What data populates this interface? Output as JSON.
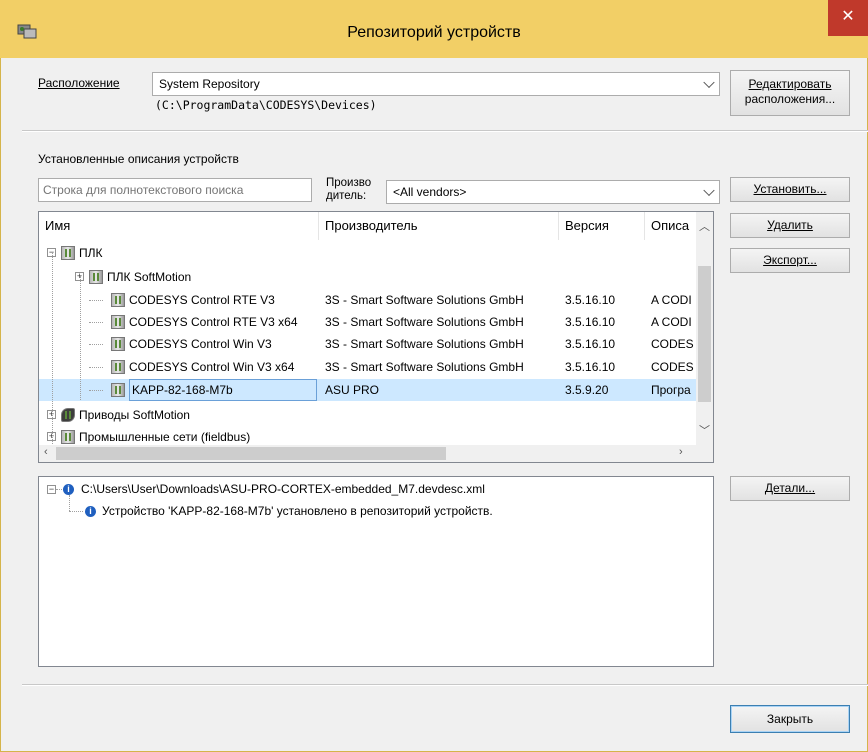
{
  "window": {
    "title": "Репозиторий устройств",
    "close_glyph": "✕"
  },
  "location": {
    "label": "Расположение",
    "selected": "System Repository",
    "path": "(C:\\ProgramData\\CODESYS\\Devices)",
    "edit_button_line1": "Редактировать",
    "edit_button_line2": "расположения..."
  },
  "installed": {
    "heading": "Установленные описания устройств",
    "search_placeholder": "Строка для полнотекстового поиска",
    "vendor_label_line1": "Произво",
    "vendor_label_line2": "дитель:",
    "vendor_selected": "<All vendors>"
  },
  "grid": {
    "columns": [
      "Имя",
      "Производитель",
      "Версия",
      "Описа"
    ],
    "rows": [
      {
        "name": "ПЛК",
        "vendor": "",
        "version": "",
        "desc": "",
        "expander": "−"
      },
      {
        "name": "ПЛК SoftMotion",
        "vendor": "",
        "version": "",
        "desc": "",
        "expander": "+"
      },
      {
        "name": "CODESYS Control RTE V3",
        "vendor": "3S - Smart Software Solutions GmbH",
        "version": "3.5.16.10",
        "desc": "A CODI"
      },
      {
        "name": "CODESYS Control RTE V3 x64",
        "vendor": "3S - Smart Software Solutions GmbH",
        "version": "3.5.16.10",
        "desc": "A CODI"
      },
      {
        "name": "CODESYS Control Win V3",
        "vendor": "3S - Smart Software Solutions GmbH",
        "version": "3.5.16.10",
        "desc": "CODES"
      },
      {
        "name": "CODESYS Control Win V3 x64",
        "vendor": "3S - Smart Software Solutions GmbH",
        "version": "3.5.16.10",
        "desc": "CODES"
      },
      {
        "name": "KAPP-82-168-M7b",
        "vendor": "ASU PRO",
        "version": "3.5.9.20",
        "desc": "Програ",
        "selected": true
      },
      {
        "name": "Приводы SoftMotion",
        "vendor": "",
        "version": "",
        "desc": "",
        "expander": "+"
      },
      {
        "name": "Промышленные сети (fieldbus)",
        "vendor": "",
        "version": "",
        "desc": "",
        "expander": "+"
      }
    ]
  },
  "buttons": {
    "install": "Установить...",
    "delete": "Удалить",
    "export": "Экспорт...",
    "details": "Детали...",
    "close": "Закрыть"
  },
  "log": {
    "file": "C:\\Users\\User\\Downloads\\ASU-PRO-CORTEX-embedded_M7.devdesc.xml",
    "message": "Устройство 'KAPP-82-168-M7b' установлено в репозиторий устройств.",
    "expander": "−",
    "info_glyph": "i"
  },
  "icons": {
    "app": "device-repository-icon",
    "info": "info-icon",
    "device": "device-icon"
  }
}
